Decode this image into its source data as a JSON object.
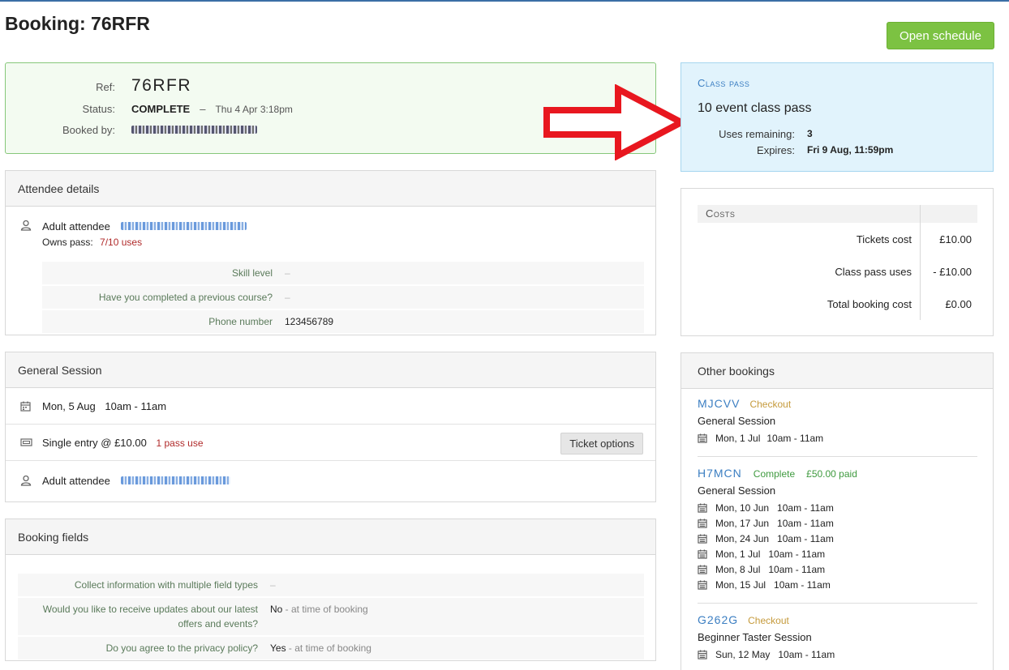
{
  "page": {
    "title": "Booking: 76RFR",
    "open_schedule_label": "Open schedule"
  },
  "summary": {
    "ref_label": "Ref:",
    "ref": "76RFR",
    "status_label": "Status:",
    "status": "COMPLETE",
    "status_sep": "–",
    "status_date": "Thu 4 Apr 3:18pm",
    "booked_by_label": "Booked by:"
  },
  "attendee_details": {
    "heading": "Attendee details",
    "attendee_label": "Adult attendee",
    "owns_pass_label": "Owns pass:",
    "owns_pass_value": "7/10 uses",
    "fields": [
      {
        "label": "Skill level",
        "value": "–"
      },
      {
        "label": "Have you completed a previous course?",
        "value": "–"
      },
      {
        "label": "Phone number",
        "value": "123456789"
      }
    ]
  },
  "general_session": {
    "heading": "General Session",
    "date": "Mon, 5 Aug",
    "time": "10am - 11am",
    "ticket": "Single entry @ £10.00",
    "pass_use": "1 pass use",
    "ticket_options_label": "Ticket options",
    "attendee_label": "Adult attendee"
  },
  "booking_fields": {
    "heading": "Booking fields",
    "fields": [
      {
        "label": "Collect information with multiple field types",
        "value": "–",
        "note": ""
      },
      {
        "label": "Would you like to receive updates about our latest offers and events?",
        "value": "No",
        "note": " - at time of booking"
      },
      {
        "label": "Do you agree to the privacy policy?",
        "value": "Yes",
        "note": " - at time of booking"
      }
    ]
  },
  "class_pass": {
    "heading": "Class pass",
    "name": "10 event class pass",
    "uses_label": "Uses remaining:",
    "uses_value": "3",
    "expires_label": "Expires:",
    "expires_value": "Fri 9 Aug, 11:59pm"
  },
  "costs": {
    "heading": "Costs",
    "rows": [
      {
        "label": "Tickets cost",
        "value": "£10.00"
      },
      {
        "label": "Class pass uses",
        "value": "- £10.00"
      },
      {
        "label": "Total booking cost",
        "value": "£0.00"
      }
    ]
  },
  "other_bookings": {
    "heading": "Other bookings",
    "items": [
      {
        "ref": "MJCVV",
        "status": "Checkout",
        "paid": "",
        "session": "General Session",
        "dates": [
          {
            "date": "Mon, 1 Jul",
            "time": "10am - 11am"
          }
        ]
      },
      {
        "ref": "H7MCN",
        "status": "Complete",
        "paid": "£50.00 paid",
        "session": "General Session",
        "dates": [
          {
            "date": "Mon, 10 Jun",
            "time": "10am - 11am"
          },
          {
            "date": "Mon, 17 Jun",
            "time": "10am - 11am"
          },
          {
            "date": "Mon, 24 Jun",
            "time": "10am - 11am"
          },
          {
            "date": "Mon, 1 Jul",
            "time": "10am - 11am"
          },
          {
            "date": "Mon, 8 Jul",
            "time": "10am - 11am"
          },
          {
            "date": "Mon, 15 Jul",
            "time": "10am - 11am"
          }
        ]
      },
      {
        "ref": "G262G",
        "status": "Checkout",
        "paid": "",
        "session": "Beginner Taster Session",
        "dates": [
          {
            "date": "Sun, 12 May",
            "time": "10am - 11am"
          }
        ]
      }
    ]
  },
  "colors": {
    "primary_button": "#7cc242",
    "summary_bg": "#f3fbf1",
    "class_pass_bg": "#e1f3fc",
    "link": "#3b7ec2",
    "annotation_arrow": "#e8171f"
  }
}
